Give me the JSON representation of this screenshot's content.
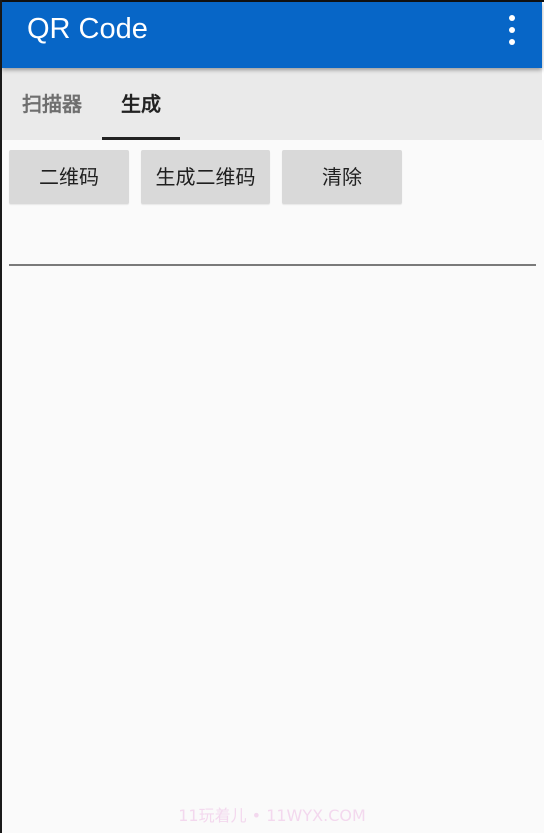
{
  "appbar": {
    "title": "QR Code",
    "color": "#0766c7"
  },
  "overflow_menu": {
    "icon": "more-vert-icon"
  },
  "tabs": [
    {
      "label": "扫描器",
      "selected": false
    },
    {
      "label": "生成",
      "selected": true
    }
  ],
  "buttons": {
    "qrcode": "二维码",
    "generate": "生成二维码",
    "clear": "清除"
  },
  "input": {
    "value": "",
    "placeholder": ""
  },
  "watermark": "11玩着儿 • 11WYX.COM"
}
